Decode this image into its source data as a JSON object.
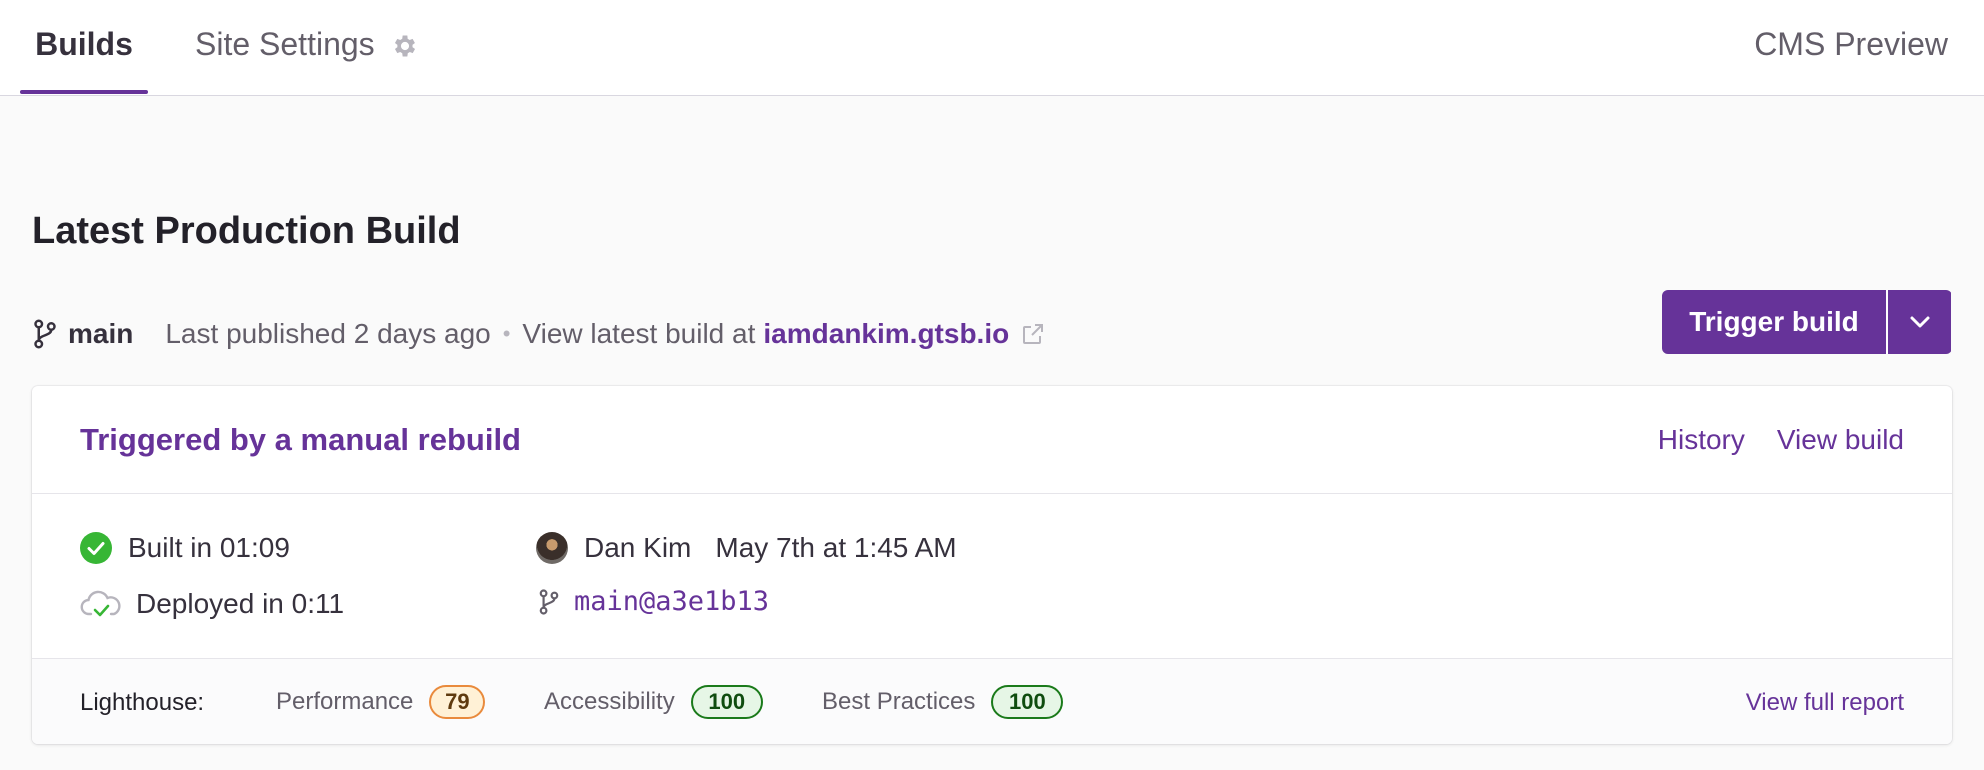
{
  "tabs": {
    "builds_label": "Builds",
    "settings_label": "Site Settings",
    "preview_label": "CMS Preview"
  },
  "header": {
    "title": "Latest Production Build"
  },
  "branch_meta": {
    "branch": "main",
    "last_published": "Last published 2 days ago",
    "separator": "•",
    "view_prefix": "View latest build at",
    "site_url": "iamdankim.gtsb.io"
  },
  "trigger": {
    "label": "Trigger build"
  },
  "build_card": {
    "title": "Triggered by a manual rebuild",
    "history_link": "History",
    "view_build_link": "View build",
    "built_text": "Built in 01:09",
    "deployed_text": "Deployed in 0:11",
    "author": "Dan Kim",
    "date": "May 7th at 1:45 AM",
    "commit": "main@a3e1b13"
  },
  "lighthouse": {
    "label": "Lighthouse:",
    "metrics": [
      {
        "name": "Performance",
        "score": "79",
        "status": "warning"
      },
      {
        "name": "Accessibility",
        "score": "100",
        "status": "good"
      },
      {
        "name": "Best Practices",
        "score": "100",
        "status": "good"
      }
    ],
    "report_link": "View full report"
  },
  "colors": {
    "accent": "#663399",
    "success": "#37b635",
    "warning": "#e98a3c"
  },
  "icons": [
    "gear-icon",
    "git-branch-icon",
    "external-link-icon",
    "chevron-down-icon",
    "check-circle-icon",
    "cloud-check-icon"
  ]
}
